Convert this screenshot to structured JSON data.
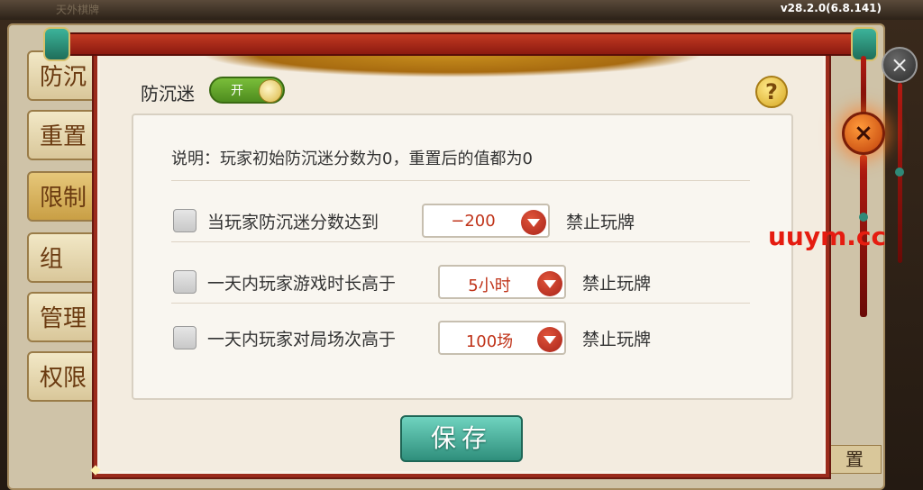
{
  "version": "v28.2.0(6.8.141)",
  "top_faded_text": "天外棋牌",
  "side_tabs": [
    "防沉",
    "重置",
    "限制",
    "组",
    "管理",
    "权限"
  ],
  "bg_right_button": "置",
  "dialog": {
    "title": "防沉迷",
    "toggle": {
      "label": "开",
      "state": "on"
    },
    "help_label": "?",
    "description": "说明：玩家初始防沉迷分数为0，重置后的值都为0",
    "rules": [
      {
        "checked": false,
        "label": "当玩家防沉迷分数达到",
        "value": "−200",
        "suffix": "禁止玩牌"
      },
      {
        "checked": false,
        "label": "一天内玩家游戏时长高于",
        "value": "5小时",
        "suffix": "禁止玩牌"
      },
      {
        "checked": false,
        "label": "一天内玩家对局场次高于",
        "value": "100场",
        "suffix": "禁止玩牌"
      }
    ],
    "save_label": "保存"
  },
  "close_buttons": [
    "×",
    "×"
  ],
  "watermark": "uuym.cc",
  "colors": {
    "accent_red": "#c0341a",
    "frame": "#9b2b1c",
    "save_green": "#2f8f7c",
    "toggle_green": "#5fa02a"
  }
}
